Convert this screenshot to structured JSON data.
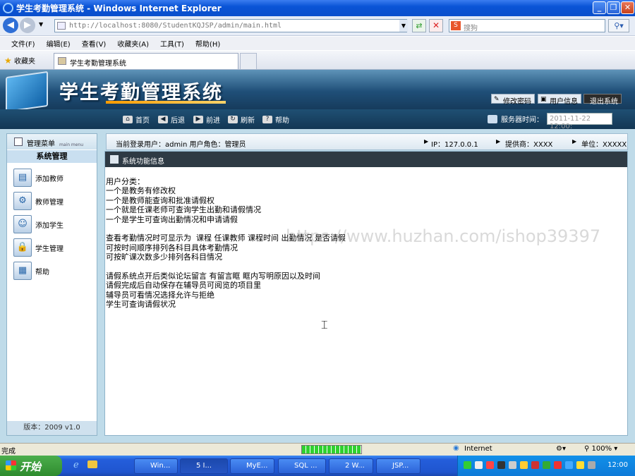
{
  "window": {
    "title": "学生考勤管理系统 - Windows Internet Explorer",
    "address": "http://localhost:8080/StudentKQJSP/admin/main.html",
    "address_host": "localhost",
    "search_placeholder": "搜狗"
  },
  "menubar": [
    "文件(F)",
    "编辑(E)",
    "查看(V)",
    "收藏夹(A)",
    "工具(T)",
    "帮助(H)"
  ],
  "favorites": {
    "label": "收藏夹",
    "tab_title": "学生考勤管理系统"
  },
  "app": {
    "title": "学生考勤管理系统",
    "top_buttons": [
      "修改密码",
      "用户信息",
      "退出系统"
    ],
    "toolbar": [
      "首页",
      "后退",
      "前进",
      "刷新",
      "帮助"
    ],
    "server_time_label": "服务器时间：",
    "server_time": "2011-11-22 12:00:"
  },
  "sidebar": {
    "header": "管理菜单",
    "header_sub": "main menu",
    "section": "系统管理",
    "items": [
      {
        "label": "添加教师",
        "icon": "add-teacher-icon"
      },
      {
        "label": "教师管理",
        "icon": "gear-icon"
      },
      {
        "label": "添加学生",
        "icon": "user-icon"
      },
      {
        "label": "学生管理",
        "icon": "lock-icon"
      },
      {
        "label": "帮助",
        "icon": "help-icon"
      }
    ],
    "version": "版本：2009 v1.0"
  },
  "infobar": {
    "user": "当前登录用户：admin  用户角色：管理员",
    "ip": "IP：127.0.0.1",
    "provider": "提供商：XXXX",
    "unit": "单位：XXXXX"
  },
  "content": {
    "header": "系统功能信息",
    "lines": [
      "用户分类：",
      "一个是教务有修改权",
      "一个是教师能查询和批准请假权",
      "一个就是任课老师可查询学生出勤和请假情况",
      "一个是学生可查询出勤情况和申请请假",
      "",
      "查看考勤情况时可显示为  课程 任课教师 课程时间 出勤情况 是否请假",
      "可按时间顺序排列各科目具体考勤情况",
      "可按旷课次数多少排列各科目情况",
      "",
      "请假系统点开后类似论坛留言 有留言眶 眶内写明原因以及时间",
      "请假完成后自动保存在辅导员可阅览的项目里",
      "辅导员可看情况选择允许与拒绝",
      "学生可查询请假状况"
    ],
    "watermark": "https://www.huzhan.com/ishop39397"
  },
  "statusbar": {
    "left": "完成",
    "zone": "Internet",
    "zoom": "100%"
  },
  "taskbar": {
    "start": "开始",
    "tasks": [
      "Win...",
      "5 I...",
      "MyE...",
      "SQL ...",
      "2 W...",
      "JSP..."
    ],
    "clock": "12:00"
  }
}
